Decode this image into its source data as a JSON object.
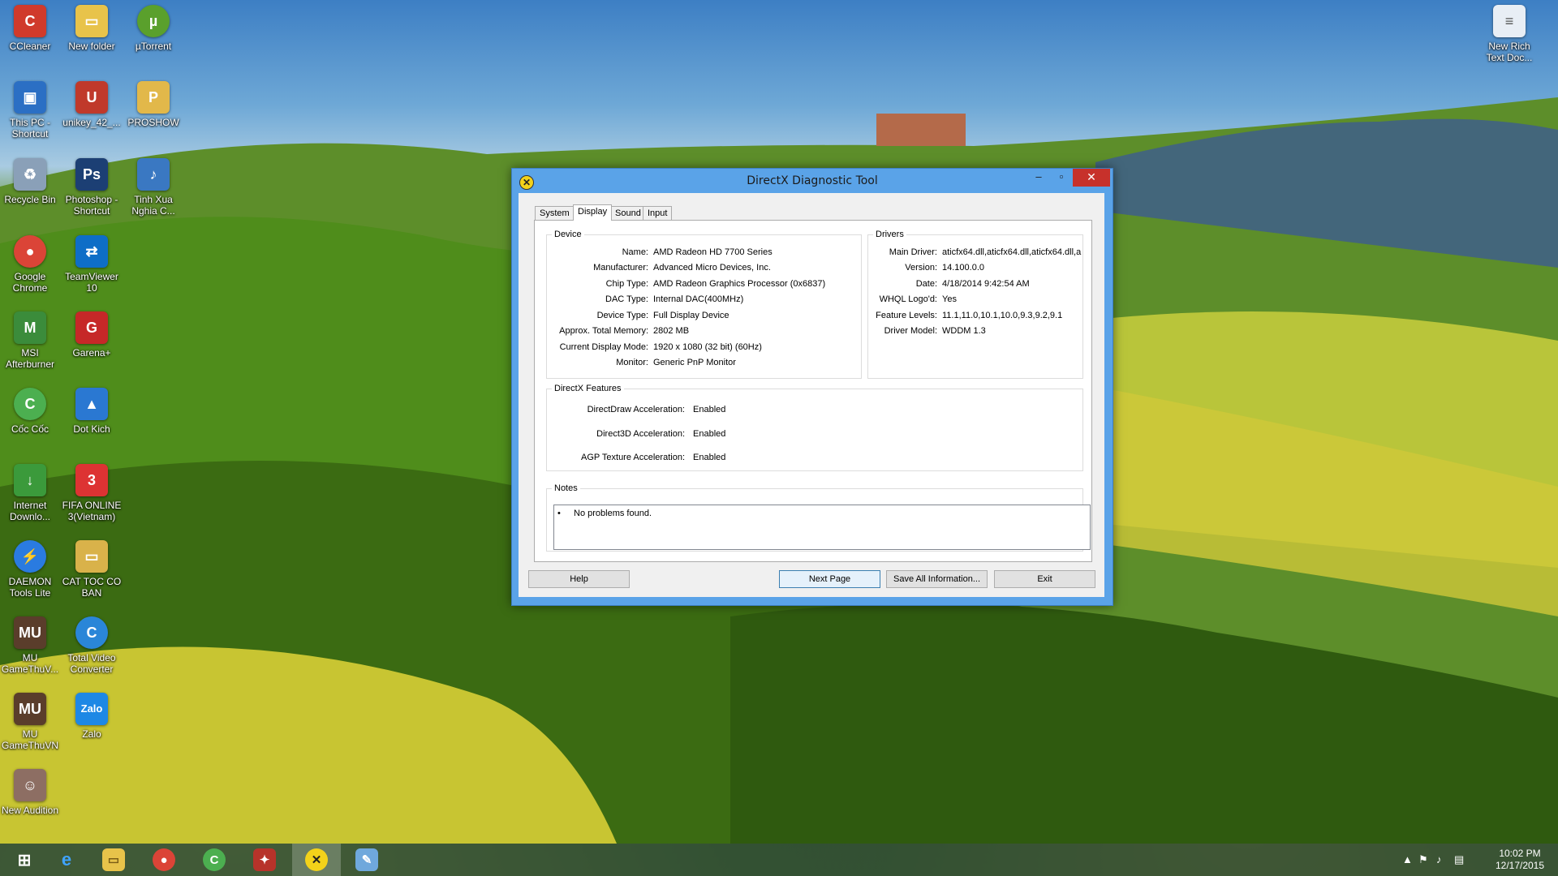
{
  "desktop": {
    "icons": [
      {
        "label": "CCleaner",
        "icon": "ccleaner-icon",
        "color": "#d03a2b"
      },
      {
        "label": "New folder",
        "icon": "folder-icon",
        "color": "#e8c34a"
      },
      {
        "label": "µTorrent",
        "icon": "utorrent-icon",
        "color": "#5aa02c"
      },
      {
        "label": "This PC - Shortcut",
        "icon": "this-pc-icon",
        "color": "#2b6fc4"
      },
      {
        "label": "unikey_42_...",
        "icon": "unikey-icon",
        "color": "#c0392b"
      },
      {
        "label": "PROSHOW",
        "icon": "proshow-icon",
        "color": "#e2b84a"
      },
      {
        "label": "Recycle Bin",
        "icon": "recycle-bin-icon",
        "color": "#8aa0b8"
      },
      {
        "label": "Photoshop - Shortcut",
        "icon": "photoshop-icon",
        "color": "#1c3f74"
      },
      {
        "label": "Tinh Xua Nghia C...",
        "icon": "mp3-file-icon",
        "color": "#3a78c2"
      },
      {
        "label": "Google Chrome",
        "icon": "chrome-icon",
        "color": "#db4437"
      },
      {
        "label": "TeamViewer 10",
        "icon": "teamviewer-icon",
        "color": "#0e6ec7"
      },
      {
        "label": "MSI Afterburner",
        "icon": "msi-afterburner-icon",
        "color": "#3b8c3b"
      },
      {
        "label": "Garena+",
        "icon": "garena-icon",
        "color": "#c62828"
      },
      {
        "label": "Cốc Cốc",
        "icon": "coccoc-icon",
        "color": "#4caf50"
      },
      {
        "label": "Dot Kich",
        "icon": "dotkich-icon",
        "color": "#2a78d2"
      },
      {
        "label": "Internet Downlo...",
        "icon": "idm-icon",
        "color": "#3b9a3b"
      },
      {
        "label": "FIFA ONLINE 3(Vietnam)",
        "icon": "fifa-icon",
        "color": "#d33"
      },
      {
        "label": "DAEMON Tools Lite",
        "icon": "daemon-tools-icon",
        "color": "#2a7be0"
      },
      {
        "label": "CAT TOC CO BAN",
        "icon": "folder-icon",
        "color": "#d9b24a"
      },
      {
        "label": "MU GameThuV...",
        "icon": "mu-game-icon",
        "color": "#5a3d2b"
      },
      {
        "label": "Total Video Converter",
        "icon": "total-video-converter-icon",
        "color": "#2a86d8"
      },
      {
        "label": "MU GameThuVN",
        "icon": "mu-game-icon",
        "color": "#5a3d2b"
      },
      {
        "label": "Zalo",
        "icon": "zalo-icon",
        "color": "#1e88e5"
      },
      {
        "label": "New Audition",
        "icon": "audition-icon",
        "color": "#8d6e63"
      },
      {
        "label": "New Rich Text Doc...",
        "icon": "document-icon",
        "color": "#e8eef5"
      }
    ]
  },
  "window": {
    "title": "DirectX Diagnostic Tool",
    "tabs": [
      "System",
      "Display",
      "Sound",
      "Input"
    ],
    "active_tab": "Display",
    "device": {
      "legend": "Device",
      "rows": [
        {
          "label": "Name:",
          "value": "AMD Radeon HD 7700 Series"
        },
        {
          "label": "Manufacturer:",
          "value": "Advanced Micro Devices, Inc."
        },
        {
          "label": "Chip Type:",
          "value": "AMD Radeon Graphics Processor (0x6837)"
        },
        {
          "label": "DAC Type:",
          "value": "Internal DAC(400MHz)"
        },
        {
          "label": "Device Type:",
          "value": "Full Display Device"
        },
        {
          "label": "Approx. Total Memory:",
          "value": "2802 MB"
        },
        {
          "label": "Current Display Mode:",
          "value": "1920 x 1080 (32 bit) (60Hz)"
        },
        {
          "label": "Monitor:",
          "value": "Generic PnP Monitor"
        }
      ]
    },
    "drivers": {
      "legend": "Drivers",
      "rows": [
        {
          "label": "Main Driver:",
          "value": "aticfx64.dll,aticfx64.dll,aticfx64.dll,a"
        },
        {
          "label": "Version:",
          "value": "14.100.0.0"
        },
        {
          "label": "Date:",
          "value": "4/18/2014 9:42:54 AM"
        },
        {
          "label": "WHQL Logo'd:",
          "value": "Yes"
        },
        {
          "label": "Feature Levels:",
          "value": "11.1,11.0,10.1,10.0,9.3,9.2,9.1"
        },
        {
          "label": "Driver Model:",
          "value": "WDDM 1.3"
        }
      ]
    },
    "features": {
      "legend": "DirectX Features",
      "rows": [
        {
          "label": "DirectDraw Acceleration:",
          "value": "Enabled"
        },
        {
          "label": "Direct3D Acceleration:",
          "value": "Enabled"
        },
        {
          "label": "AGP Texture Acceleration:",
          "value": "Enabled"
        }
      ]
    },
    "notes": {
      "legend": "Notes",
      "items": [
        "No problems found."
      ]
    },
    "buttons": {
      "help": "Help",
      "next_page": "Next Page",
      "save_all": "Save All Information...",
      "exit": "Exit"
    }
  },
  "taskbar": {
    "items": [
      {
        "icon": "windows-start-icon"
      },
      {
        "icon": "internet-explorer-icon"
      },
      {
        "icon": "file-explorer-icon"
      },
      {
        "icon": "chrome-icon"
      },
      {
        "icon": "coccoc-icon"
      },
      {
        "icon": "game-icon"
      },
      {
        "icon": "directx-icon"
      },
      {
        "icon": "paint-icon"
      }
    ],
    "clock_time": "10:02 PM",
    "clock_date": "12/17/2015"
  }
}
